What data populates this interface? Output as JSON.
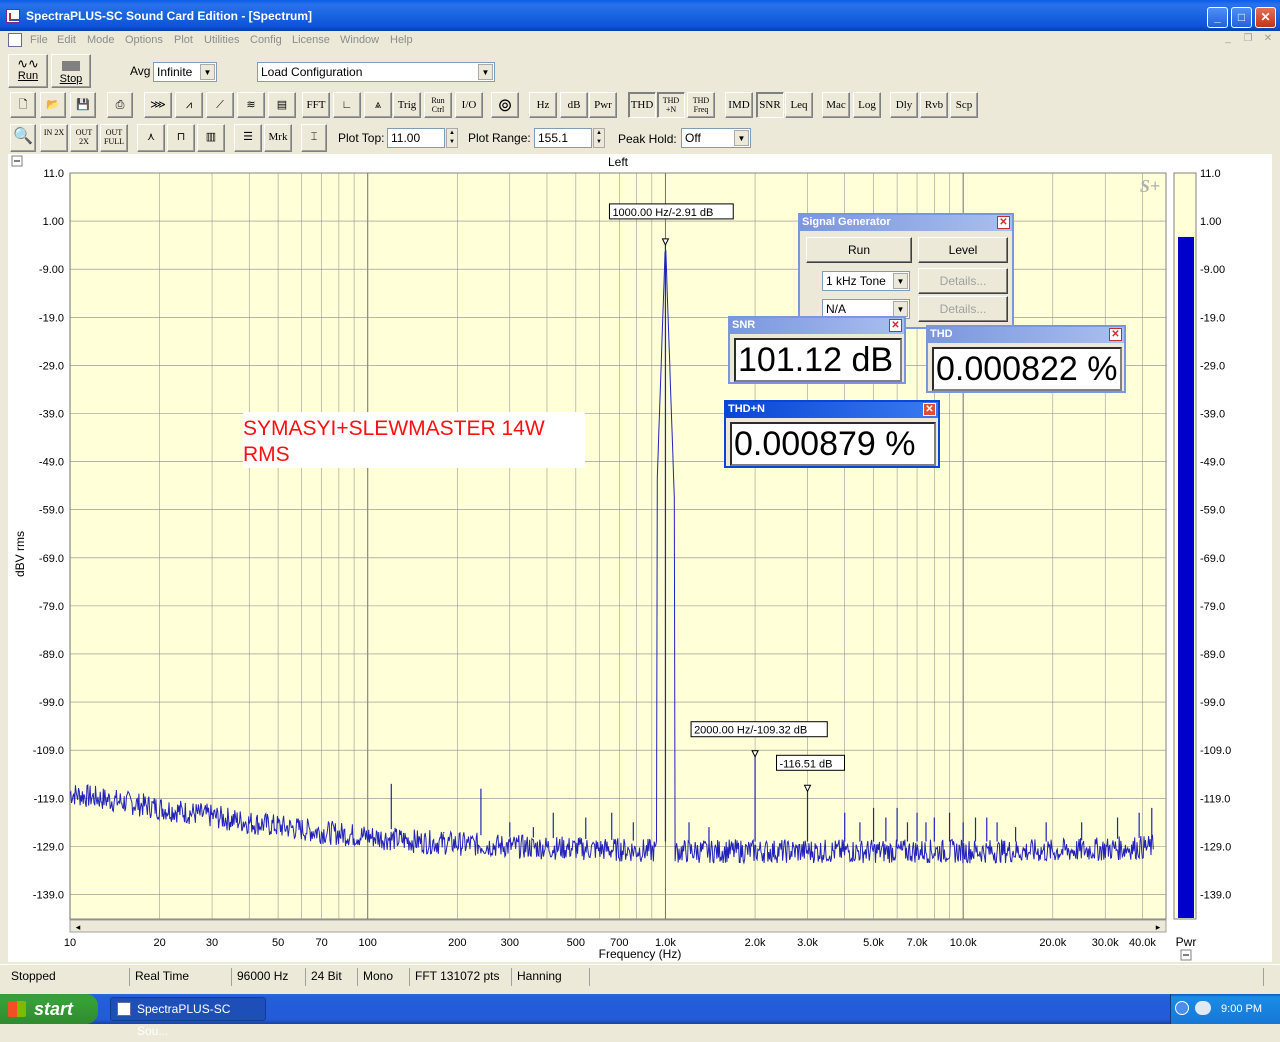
{
  "window": {
    "title": "SpectraPLUS-SC Sound Card Edition - [Spectrum]"
  },
  "menu": [
    "File",
    "Edit",
    "Mode",
    "Options",
    "Plot",
    "Utilities",
    "Config",
    "License",
    "Window",
    "Help"
  ],
  "toolbar1": {
    "run_label": "Run",
    "stop_label": "Stop",
    "avg_label": "Avg",
    "avg_value": "Infinite",
    "load_config_value": "Load Configuration"
  },
  "toolbar2": [
    "FFT",
    "Trig",
    "Run Ctrl",
    "I/O",
    "Hz",
    "dB",
    "Pwr",
    "THD",
    "THD +N",
    "THD Freq",
    "IMD",
    "SNR",
    "Leq",
    "Mac",
    "Log",
    "Dly",
    "Rvb",
    "Scp"
  ],
  "toolbar3": {
    "zoom_in_label": "IN 2X",
    "zoom_out_label": "OUT 2X",
    "full_label": "OUT FULL",
    "mrk_label": "Mrk",
    "plot_top_label": "Plot Top:",
    "plot_top_value": "11.00",
    "plot_range_label": "Plot Range:",
    "plot_range_value": "155.1",
    "peak_hold_label": "Peak Hold:",
    "peak_hold_value": "Off"
  },
  "plot": {
    "channel_label": "Left",
    "annotation_line1": "SYMASYI+SLEWMASTER 14W",
    "annotation_line2": "RMS",
    "logo": "S+",
    "markers": [
      {
        "label": "1000.00 Hz/-2.91 dB",
        "freq": 1000,
        "db": -2.91
      },
      {
        "label": "2000.00 Hz/-109.32 dB",
        "freq": 2000,
        "db": -109.32
      },
      {
        "label": "-116.51 dB",
        "freq": 3000,
        "db": -116.51
      }
    ],
    "meter_label": "Pwr",
    "meter_level_db": -2.3,
    "accent_color": "#0000cc",
    "trace_color": "#2222bb",
    "plot_bg": "#ffffd8"
  },
  "chart_data": {
    "type": "line",
    "title": "",
    "xlabel": "Frequency (Hz)",
    "ylabel": "dBV rms",
    "xscale": "log",
    "xlim": [
      10,
      48000
    ],
    "ylim": [
      -144.1,
      11.0
    ],
    "x_ticks": [
      "10",
      "20",
      "30",
      "50",
      "70",
      "100",
      "200",
      "300",
      "500",
      "700",
      "1.0k",
      "2.0k",
      "3.0k",
      "5.0k",
      "7.0k",
      "10.0k",
      "20.0k",
      "30.0k",
      "40.0k"
    ],
    "x_tick_values": [
      10,
      20,
      30,
      50,
      70,
      100,
      200,
      300,
      500,
      700,
      1000,
      2000,
      3000,
      5000,
      7000,
      10000,
      20000,
      30000,
      40000
    ],
    "y_ticks": [
      "11.0",
      "1.00",
      "-9.00",
      "-19.0",
      "-29.0",
      "-39.0",
      "-49.0",
      "-59.0",
      "-69.0",
      "-79.0",
      "-89.0",
      "-99.0",
      "-109.0",
      "-119.0",
      "-129.0",
      "-139.0"
    ],
    "y_tick_values": [
      11,
      1,
      -9,
      -19,
      -29,
      -39,
      -49,
      -59,
      -69,
      -79,
      -89,
      -99,
      -109,
      -119,
      -129,
      -139
    ],
    "noise_floor": [
      [
        10,
        -118
      ],
      [
        20,
        -121
      ],
      [
        40,
        -124
      ],
      [
        70,
        -126
      ],
      [
        150,
        -128
      ],
      [
        300,
        -129
      ],
      [
        1000,
        -130
      ],
      [
        5000,
        -130
      ],
      [
        20000,
        -130
      ],
      [
        48000,
        -129
      ]
    ],
    "peaks": [
      [
        1000,
        -2.91
      ],
      [
        2000,
        -109.32
      ],
      [
        3000,
        -116.51
      ],
      [
        120,
        -116
      ],
      [
        240,
        -117
      ],
      [
        180,
        -126
      ],
      [
        300,
        -124
      ],
      [
        360,
        -125
      ],
      [
        420,
        -122
      ],
      [
        540,
        -123
      ],
      [
        660,
        -122
      ],
      [
        780,
        -124
      ],
      [
        1200,
        -124
      ],
      [
        1400,
        -125
      ],
      [
        4000,
        -122
      ],
      [
        4500,
        -124
      ],
      [
        5000,
        -121
      ],
      [
        5500,
        -123
      ],
      [
        6000,
        -121
      ],
      [
        6500,
        -124
      ],
      [
        7000,
        -122
      ],
      [
        7500,
        -124
      ],
      [
        8000,
        -123
      ],
      [
        9000,
        -122
      ],
      [
        10000,
        -124
      ],
      [
        11000,
        -123
      ],
      [
        12000,
        -123
      ],
      [
        13000,
        -124
      ],
      [
        15000,
        -125
      ],
      [
        19000,
        -124
      ],
      [
        25000,
        -124
      ],
      [
        33000,
        -123
      ],
      [
        39000,
        -122
      ],
      [
        43000,
        -121
      ]
    ]
  },
  "signal_generator": {
    "title": "Signal Generator",
    "run_label": "Run",
    "level_label": "Level",
    "tone_value": "1 kHz Tone",
    "na_value": "N/A",
    "details1_label": "Details...",
    "details2_label": "Details..."
  },
  "snr": {
    "title": "SNR",
    "value": "101.12 dB"
  },
  "thd": {
    "title": "THD",
    "value": "0.000822 %"
  },
  "thdn": {
    "title": "THD+N",
    "value": "0.000879 %"
  },
  "status": [
    "Stopped",
    "Real Time",
    "96000 Hz",
    "24 Bit",
    "Mono",
    "FFT 131072 pts",
    "Hanning"
  ],
  "taskbar": {
    "start_label": "start",
    "task_label": "SpectraPLUS-SC Sou...",
    "clock": "9:00 PM"
  }
}
